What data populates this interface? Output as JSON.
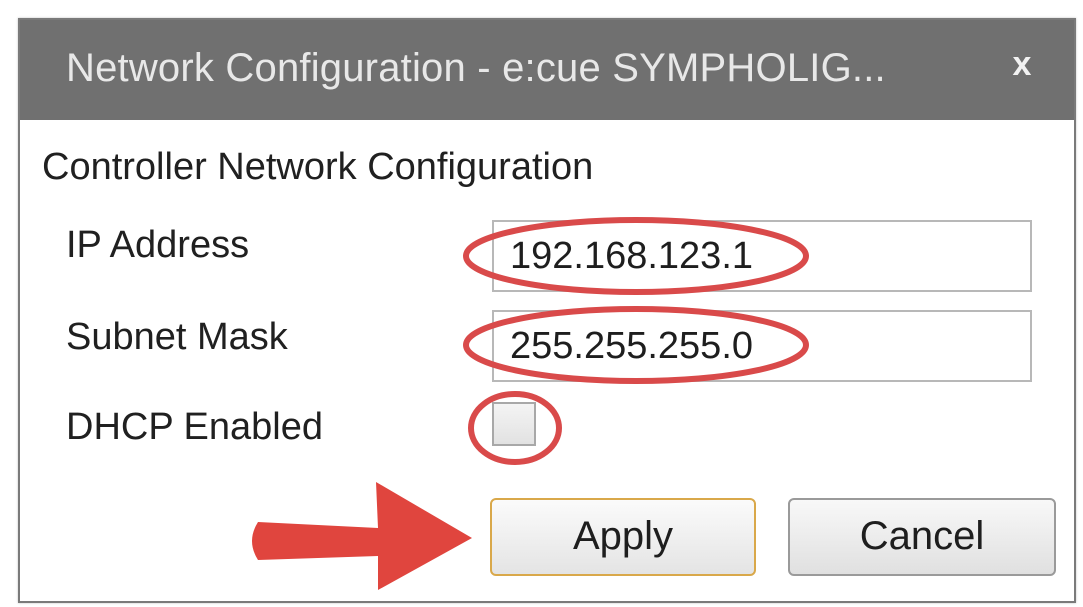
{
  "window": {
    "title": "Network Configuration - e:cue SYMPHOLIG...",
    "close_glyph": "x"
  },
  "group": {
    "title": "Controller Network Configuration"
  },
  "fields": {
    "ip_label": "IP Address",
    "ip_value": "192.168.123.1",
    "subnet_label": "Subnet Mask",
    "subnet_value": "255.255.255.0",
    "dhcp_label": "DHCP Enabled",
    "dhcp_checked": false
  },
  "buttons": {
    "apply_label": "Apply",
    "cancel_label": "Cancel"
  },
  "colors": {
    "titlebar": "#707070",
    "annotation_red": "#d94a4a",
    "arrow_red": "#e0453e",
    "apply_focus_border": "#d9a84a"
  }
}
